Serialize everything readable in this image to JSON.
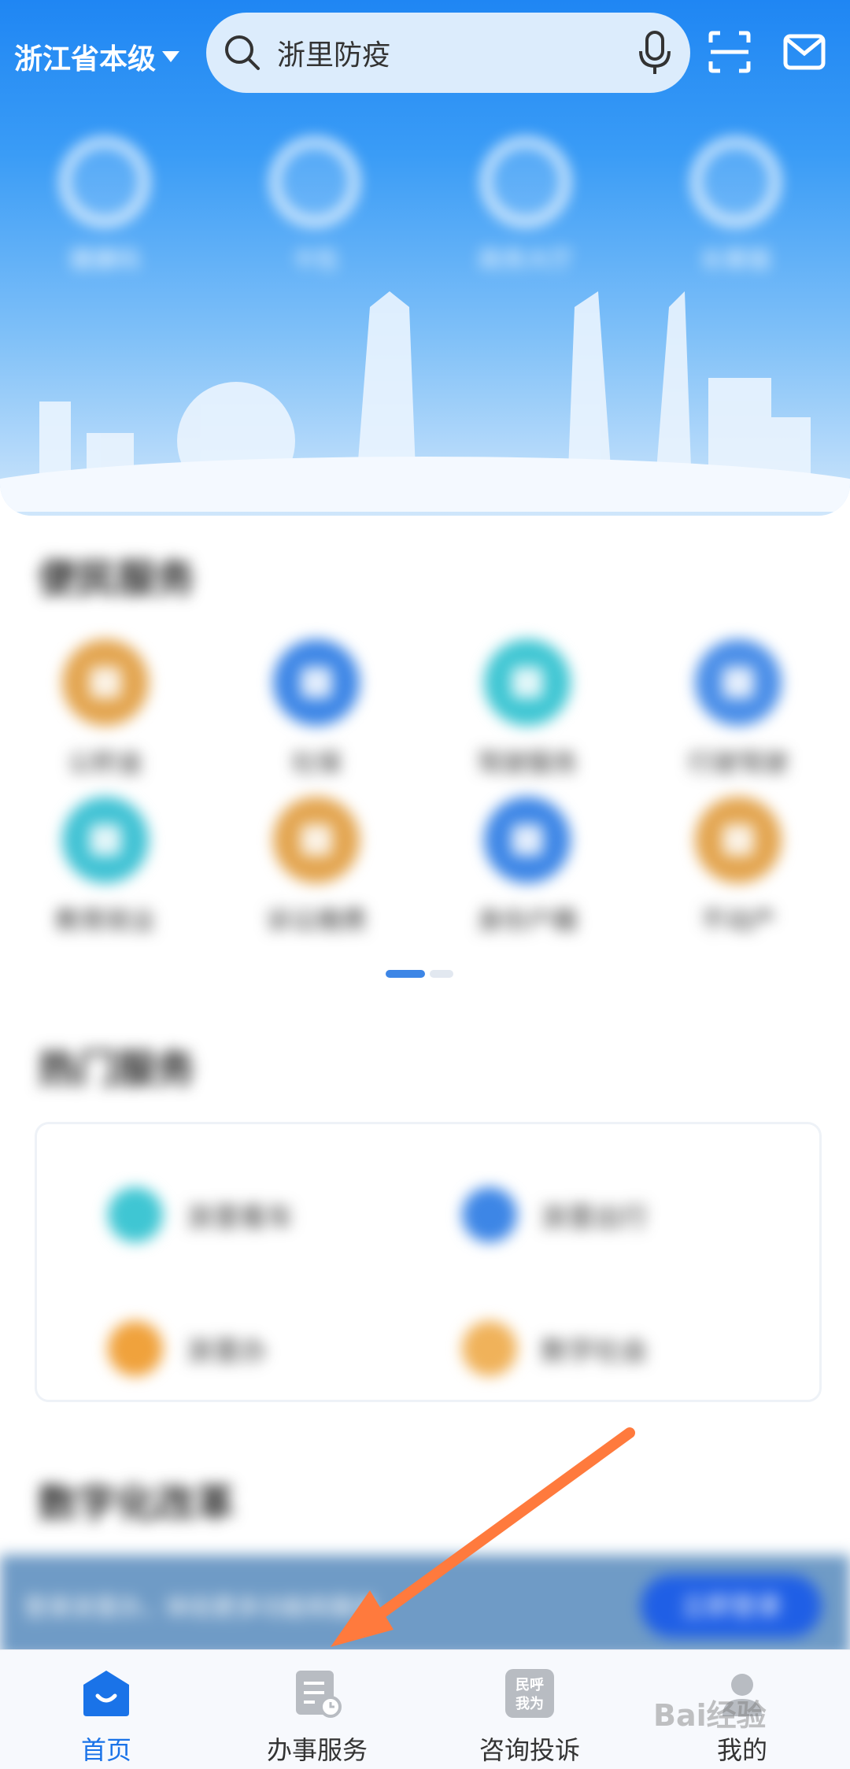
{
  "header": {
    "region": "浙江省本级",
    "search_placeholder": "浙里防疫",
    "icons": [
      "search-icon",
      "microphone-icon",
      "scan-icon",
      "mail-icon"
    ]
  },
  "quick_entries": [
    {
      "label": "健康码",
      "icon": "health-code-icon"
    },
    {
      "label": "卡包",
      "icon": "wallet-icon"
    },
    {
      "label": "政务大厅",
      "icon": "hall-icon"
    },
    {
      "label": "长辈版",
      "icon": "elder-icon"
    }
  ],
  "sections": {
    "convenience": "便民服务",
    "hot": "热门服务",
    "digital": "数字化改革"
  },
  "convenience_services": [
    {
      "label": "公积金",
      "color": "#e3a550"
    },
    {
      "label": "社保",
      "color": "#3d86e6"
    },
    {
      "label": "驾驶服务",
      "color": "#3fc6d3"
    },
    {
      "label": "行驶驾驶",
      "color": "#4a8ee8"
    },
    {
      "label": "教育就业",
      "color": "#40c2d4"
    },
    {
      "label": "诉讼缴费",
      "color": "#e3a550"
    },
    {
      "label": "身份户籍",
      "color": "#3d86e6"
    },
    {
      "label": "不动产",
      "color": "#e3a550"
    }
  ],
  "hot_services": [
    {
      "label": "浙里看车",
      "color": "#3fc6d3"
    },
    {
      "label": "浙里出行",
      "color": "#3d86e6"
    },
    {
      "label": "浙里办",
      "color": "#f0a23c"
    },
    {
      "label": "数字社会",
      "color": "#f0b25a"
    }
  ],
  "banner": {
    "text": "登录浙里办，体验更多功能和服务",
    "button": "立即登录"
  },
  "tabs": [
    {
      "label": "首页",
      "icon": "home-icon",
      "active": true
    },
    {
      "label": "办事服务",
      "icon": "service-doc-icon",
      "active": false
    },
    {
      "label": "咨询投诉",
      "icon": "complaint-icon",
      "active": false
    },
    {
      "label": "我的",
      "icon": "profile-icon",
      "active": false
    }
  ],
  "watermark": "Bai经验",
  "colors": {
    "accent": "#1a73e8",
    "hero_top": "#1f86f3",
    "arrow": "#ff7a3d"
  }
}
